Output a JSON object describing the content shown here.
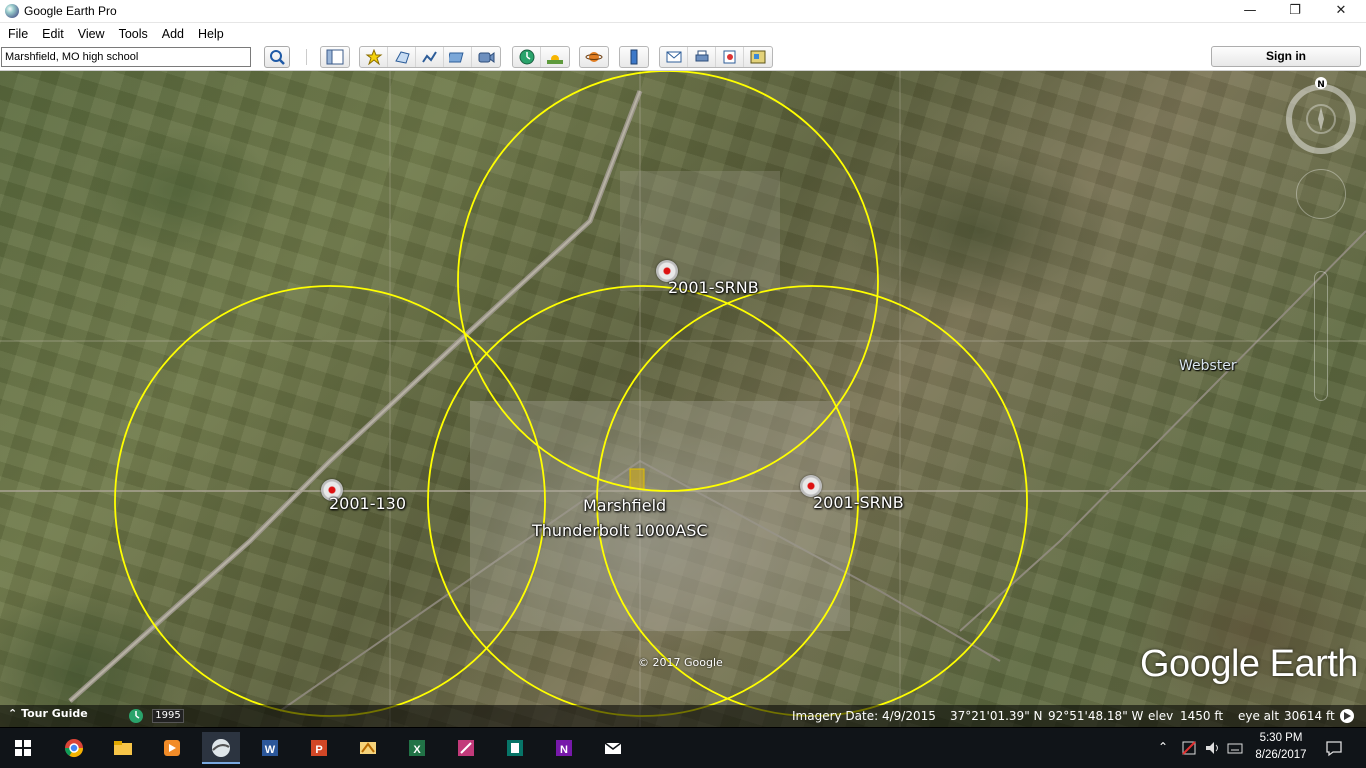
{
  "window": {
    "title": "Google Earth Pro",
    "minimize": "—",
    "maximize": "❐",
    "close": "✕"
  },
  "menu": [
    "File",
    "Edit",
    "View",
    "Tools",
    "Add",
    "Help"
  ],
  "search": {
    "value": "Marshfield, MO high school",
    "placeholder": ""
  },
  "toolbar": {
    "signin_label": "Sign in",
    "icons": [
      "sidebar-toggle",
      "placemark",
      "polygon",
      "path",
      "image-overlay",
      "record-tour",
      "historical-imagery",
      "sunlight",
      "planets",
      "ruler",
      "email",
      "print",
      "save-image",
      "view-in-maps"
    ]
  },
  "map": {
    "labels": [
      {
        "id": "label-north",
        "text": "2001-SRNB"
      },
      {
        "id": "label-west",
        "text": "2001-130"
      },
      {
        "id": "label-east",
        "text": "2001-SRNB"
      },
      {
        "id": "label-center-1",
        "text": "Marshfield"
      },
      {
        "id": "label-center-2",
        "text": "Thunderbolt 1000ASC"
      }
    ],
    "town": "Webster",
    "copyright": "© 2017 Google",
    "logo": "Google Earth",
    "compass_letter": "N",
    "circle_color": "#ffff00"
  },
  "status": {
    "tour_guide": "Tour Guide",
    "history_year": "1995",
    "imagery_date": "Imagery Date: 4/9/2015",
    "lat": "37°21'01.39\" N",
    "lon": "92°51'48.18\" W",
    "elev_label": "elev",
    "elev_value": "1450 ft",
    "eye_alt_label": "eye alt",
    "eye_alt_value": "30614 ft"
  },
  "taskbar": {
    "apps": [
      "windows-start",
      "chrome",
      "file-explorer",
      "media-player",
      "google-earth",
      "word",
      "powerpoint",
      "sketch",
      "excel",
      "onenote-purple",
      "publisher",
      "onenote",
      "mail"
    ],
    "time": "5:30 PM",
    "date": "8/26/2017"
  }
}
